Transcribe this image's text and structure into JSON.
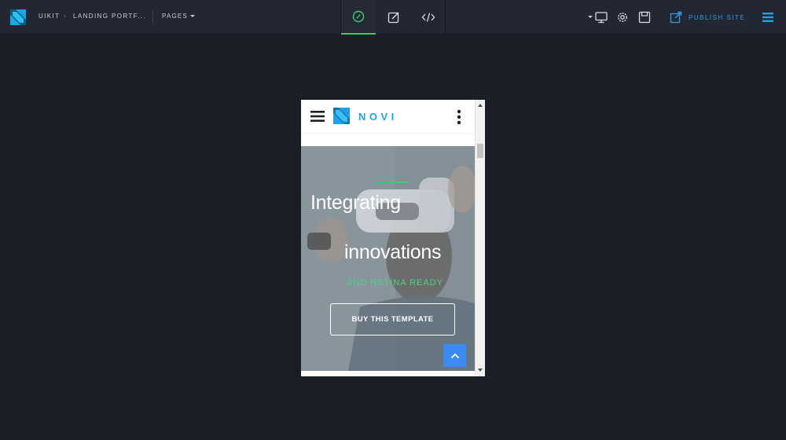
{
  "topbar": {
    "breadcrumb": {
      "project": "UIKIT",
      "separator": "›",
      "page": "LANDING PORTF..."
    },
    "pages_menu": {
      "label": "PAGES"
    },
    "modes": [
      {
        "name": "design",
        "icon": "compass-icon",
        "active": true
      },
      {
        "name": "edit",
        "icon": "edit-icon",
        "active": false
      },
      {
        "name": "code",
        "icon": "code-icon",
        "active": false
      }
    ],
    "device_icon": "monitor-icon",
    "publish_label": "PUBLISH SITE"
  },
  "preview": {
    "brand": "NOVI",
    "hero": {
      "title_line1": "Integrating",
      "title_line2": "innovations",
      "subtitle": "AND RETINA READY",
      "button_label": "BUY THIS TEMPLATE"
    }
  },
  "colors": {
    "accent_green": "#3ccc6f",
    "accent_blue": "#1ea1e8",
    "publish_blue": "#2c9ee0",
    "background": "#1b1e27",
    "topbar": "#232733"
  }
}
